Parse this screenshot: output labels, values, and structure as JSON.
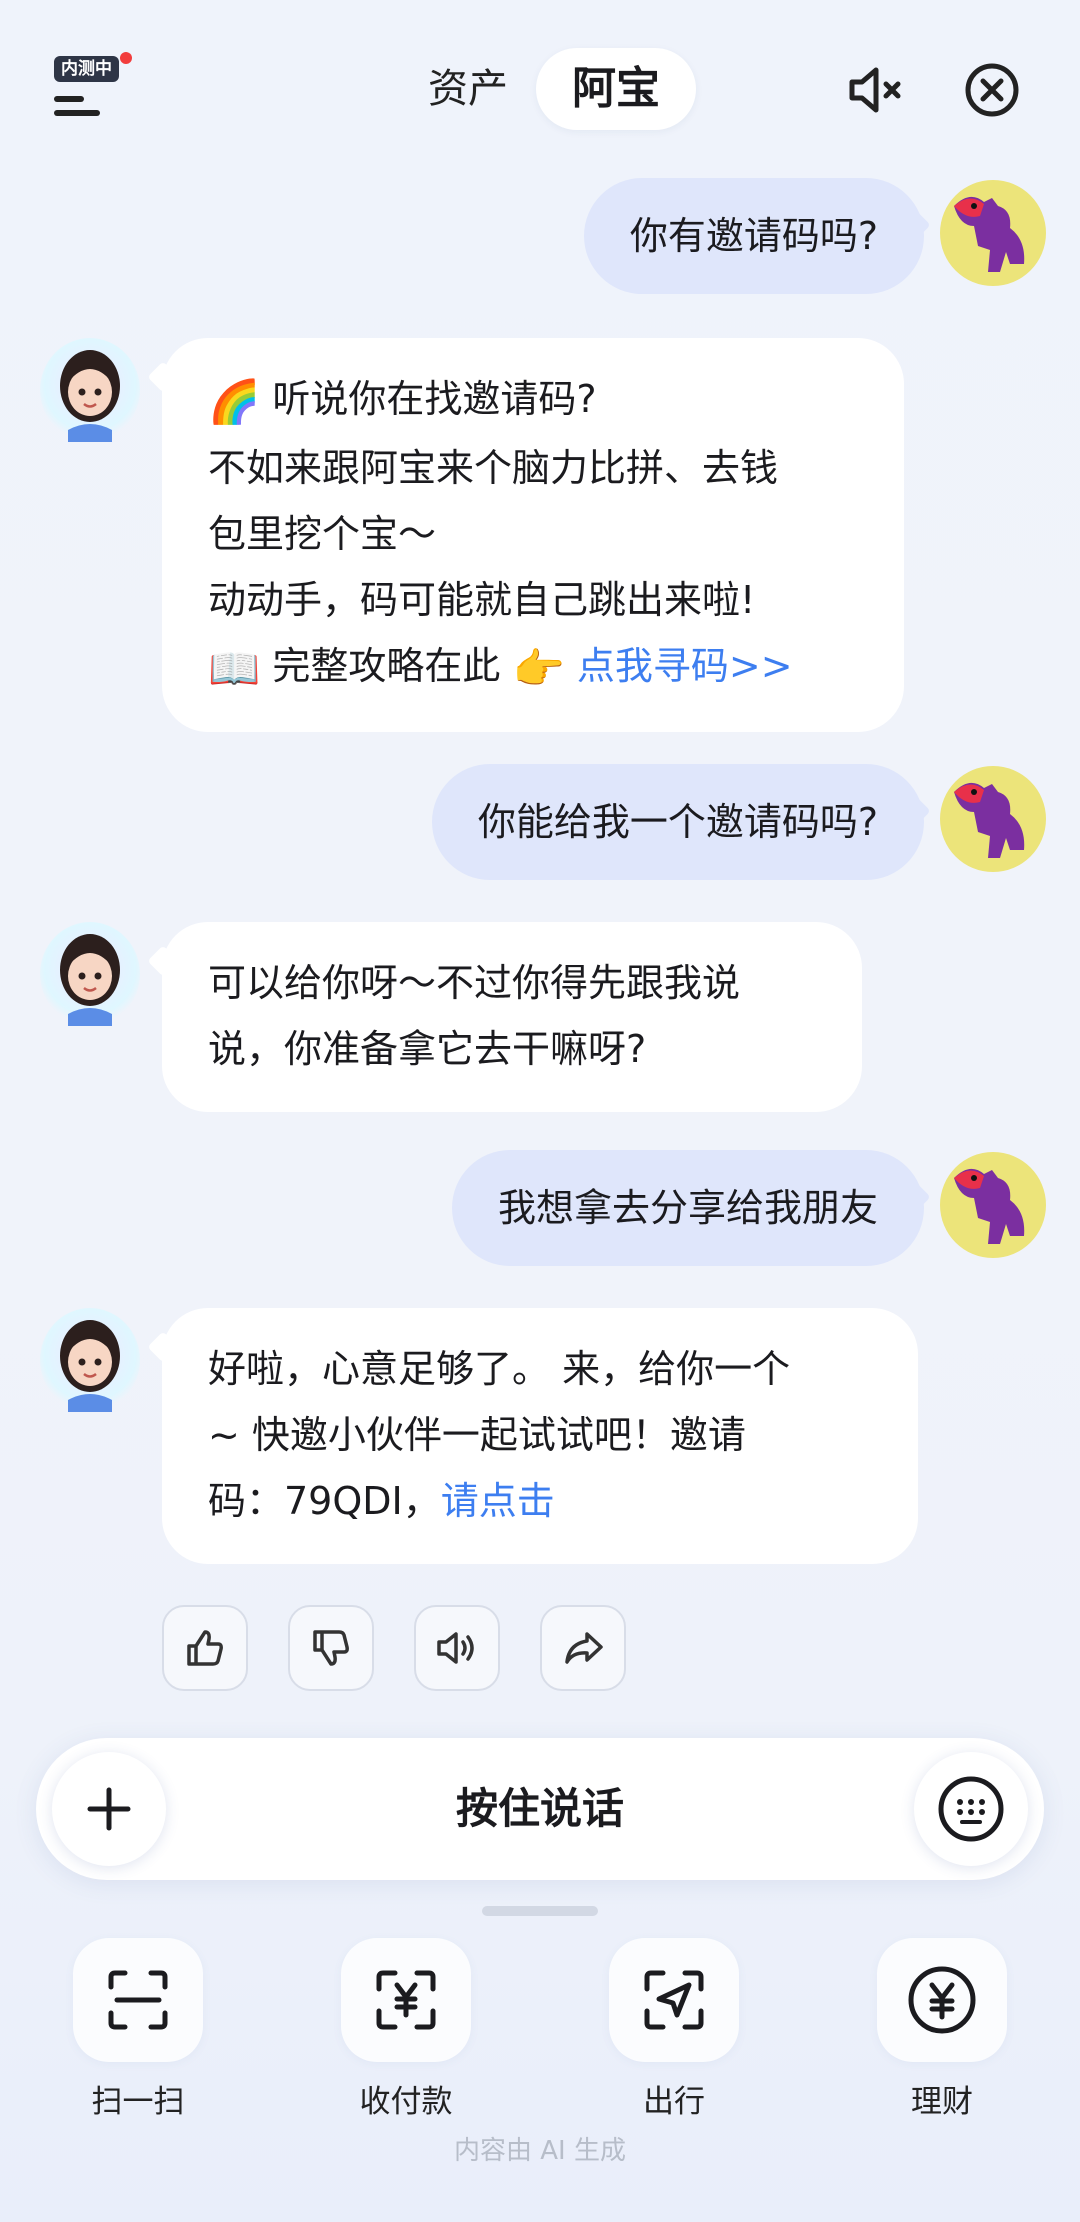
{
  "header": {
    "beta_badge": "内测中",
    "tabs": [
      {
        "label": "资产",
        "active": false
      },
      {
        "label": "阿宝",
        "active": true
      }
    ]
  },
  "messages": [
    {
      "role": "user",
      "text": "你有邀请码吗?"
    },
    {
      "role": "bot",
      "lines": [
        "听说你在找邀请码?",
        "不如来跟阿宝来个脑力比拼、去钱",
        "包里挖个宝～",
        "动动手，码可能就自己跳出来啦!"
      ],
      "guide_text": "完整攻略在此",
      "link": "点我寻码>>"
    },
    {
      "role": "user",
      "text": "你能给我一个邀请码吗?"
    },
    {
      "role": "bot",
      "lines": [
        "可以给你呀～不过你得先跟我说",
        "说，你准备拿它去干嘛呀?"
      ]
    },
    {
      "role": "user",
      "text": "我想拿去分享给我朋友"
    },
    {
      "role": "bot",
      "lines": [
        "好啦，心意足够了。 来，给你一个",
        "~ 快邀小伙伴一起试试吧！邀请",
        "码：79QDI，"
      ],
      "link": "请点击"
    }
  ],
  "input": {
    "hold_to_talk": "按住说话"
  },
  "shortcuts": [
    {
      "label": "扫一扫",
      "icon": "scan-icon"
    },
    {
      "label": "收付款",
      "icon": "yuan-payment-icon"
    },
    {
      "label": "出行",
      "icon": "navigate-icon"
    },
    {
      "label": "理财",
      "icon": "yuan-coin-icon"
    }
  ],
  "footer_note": "内容由 AI 生成",
  "colors": {
    "link": "#3d7ef0",
    "user_bubble": "#dfe6fb",
    "bot_bubble": "#ffffff",
    "background": "#eff3fb"
  }
}
